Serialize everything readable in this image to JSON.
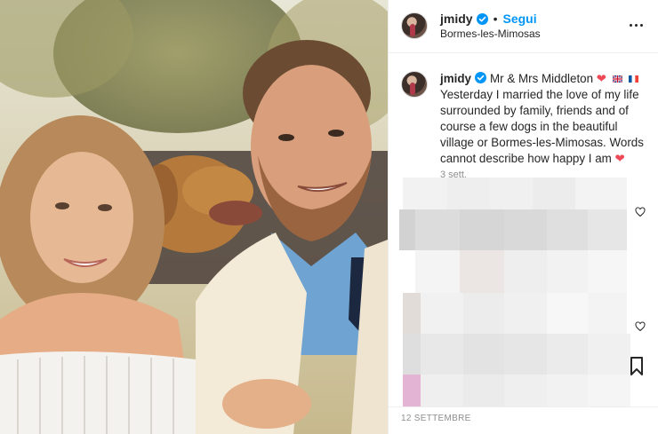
{
  "post": {
    "username": "jmidy",
    "follow_label": "Segui",
    "separator": "•",
    "location": "Bormes-les-Mimosas",
    "caption_lead": "Mr & Mrs Middleton",
    "caption_body": "Yesterday I married the love of my life surrounded by family, friends and of course a few dogs in the beautiful village or Bormes-les-Mimosas. Words cannot describe how happy I am",
    "caption_time": "3 sett.",
    "date": "12 SETTEMBRE"
  },
  "icons": {
    "verified": "verified-badge-icon",
    "more": "more-options-icon",
    "heart": "heart-icon",
    "bookmark": "bookmark-icon",
    "flags": [
      "uk-flag-icon",
      "france-flag-icon"
    ]
  },
  "colors": {
    "accent": "#0095f6",
    "heart": "#ed4956",
    "text": "#262626",
    "muted": "#8e8e8e"
  }
}
